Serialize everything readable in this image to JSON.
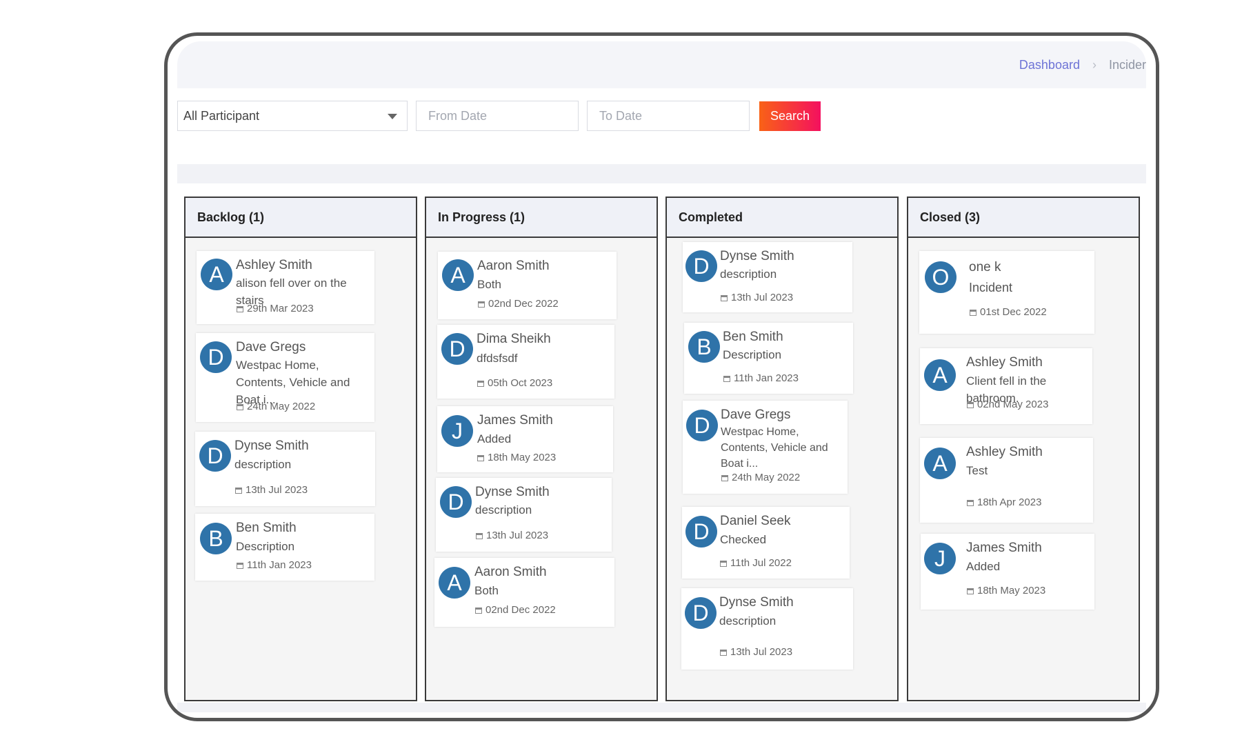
{
  "breadcrumb": {
    "home": "Dashboard",
    "current": "Incider"
  },
  "filters": {
    "participant": "All Participant",
    "from_placeholder": "From Date",
    "to_placeholder": "To Date",
    "search_label": "Search"
  },
  "columns": [
    {
      "title": "Backlog (1)",
      "cards": [
        {
          "initial": "A",
          "name": "Ashley Smith",
          "desc": "alison fell over on the stairs",
          "date": "29th Mar 2023"
        },
        {
          "initial": "D",
          "name": "Dave Gregs",
          "desc": "Westpac Home, Contents, Vehicle and Boat i...",
          "date": "24th May 2022"
        },
        {
          "initial": "D",
          "name": "Dynse Smith",
          "desc": "description",
          "date": "13th Jul 2023"
        },
        {
          "initial": "B",
          "name": "Ben Smith",
          "desc": "Description",
          "date": "11th Jan 2023"
        }
      ]
    },
    {
      "title": "In Progress (1)",
      "cards": [
        {
          "initial": "A",
          "name": "Aaron Smith",
          "desc": "Both",
          "date": "02nd Dec 2022"
        },
        {
          "initial": "D",
          "name": "Dima Sheikh",
          "desc": "dfdsfsdf",
          "date": "05th Oct 2023"
        },
        {
          "initial": "J",
          "name": "James Smith",
          "desc": "Added",
          "date": "18th May 2023"
        },
        {
          "initial": "D",
          "name": "Dynse Smith",
          "desc": "description",
          "date": "13th Jul 2023"
        },
        {
          "initial": "A",
          "name": "Aaron Smith",
          "desc": "Both",
          "date": "02nd Dec 2022"
        }
      ]
    },
    {
      "title": "Completed",
      "cards": [
        {
          "initial": "D",
          "name": "Dynse Smith",
          "desc": "description",
          "date": "13th Jul 2023"
        },
        {
          "initial": "B",
          "name": "Ben Smith",
          "desc": "Description",
          "date": "11th Jan 2023"
        },
        {
          "initial": "D",
          "name": "Dave Gregs",
          "desc": "Westpac Home, Contents, Vehicle and Boat i...",
          "date": "24th May 2022"
        },
        {
          "initial": "D",
          "name": "Daniel Seek",
          "desc": "Checked",
          "date": "11th Jul 2022"
        },
        {
          "initial": "D",
          "name": "Dynse Smith",
          "desc": "description",
          "date": "13th Jul 2023"
        }
      ]
    },
    {
      "title": "Closed (3)",
      "cards": [
        {
          "initial": "O",
          "name": "one k",
          "desc": "Incident",
          "date": "01st Dec 2022"
        },
        {
          "initial": "A",
          "name": "Ashley Smith",
          "desc": "Client fell in the bathroom.",
          "date": "02nd May 2023"
        },
        {
          "initial": "A",
          "name": "Ashley Smith",
          "desc": "Test",
          "date": "18th Apr 2023"
        },
        {
          "initial": "J",
          "name": "James Smith",
          "desc": "Added",
          "date": "18th May 2023"
        }
      ]
    }
  ],
  "colors": {
    "avatar": "#2f73a9",
    "search_start": "#f96216",
    "search_end": "#f4105f",
    "link": "#6d73d6"
  }
}
